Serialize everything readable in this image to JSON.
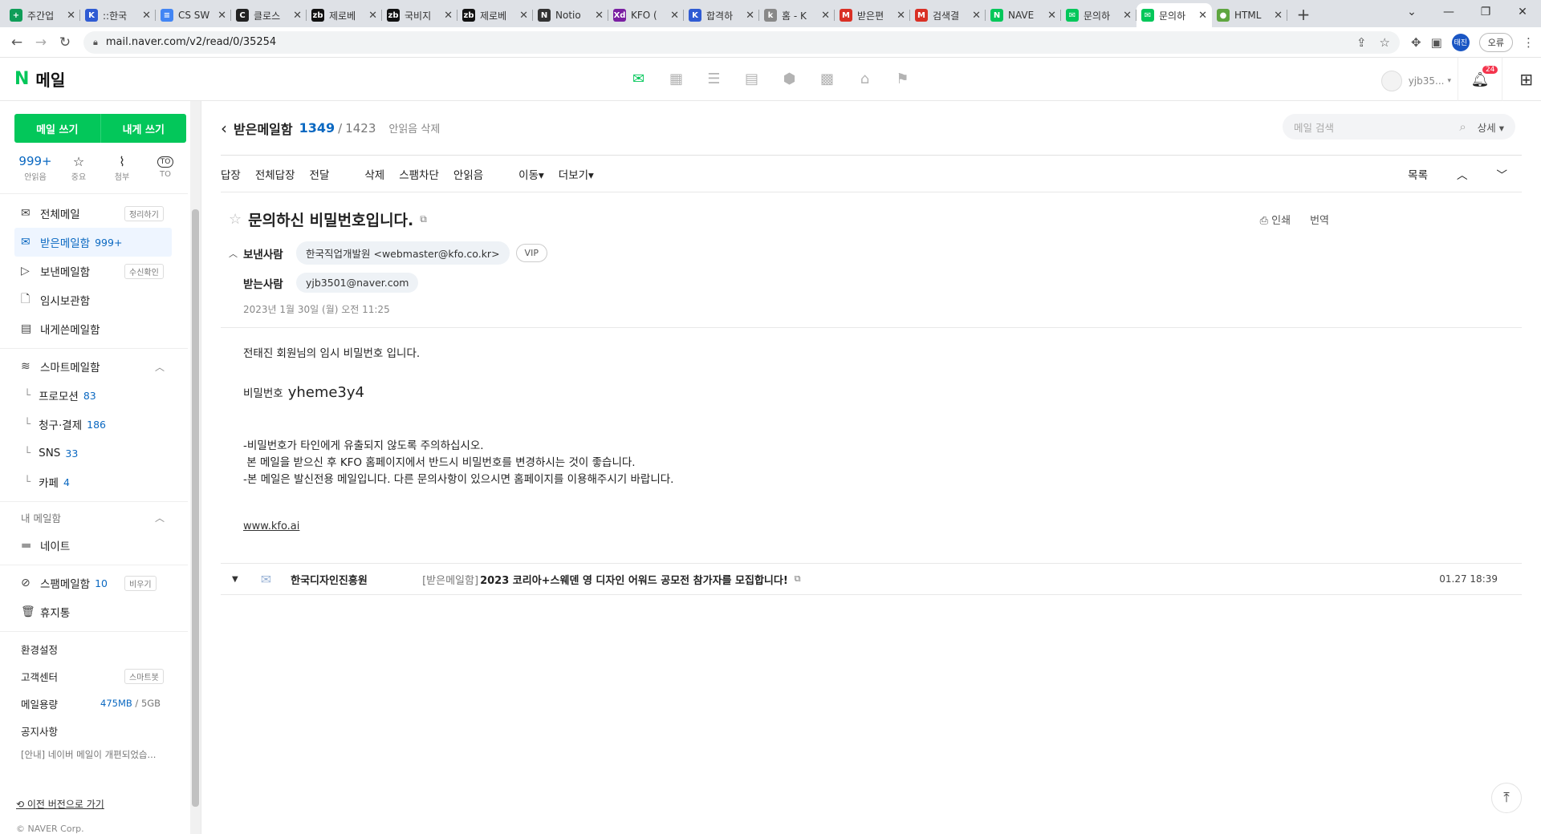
{
  "browser": {
    "tabs": [
      {
        "title": "주간업",
        "color": "#0f9d58",
        "glyph": "+"
      },
      {
        "title": "::한국",
        "color": "#2f5bd3",
        "glyph": "K"
      },
      {
        "title": "CS SW",
        "color": "#4285f4",
        "glyph": "≡"
      },
      {
        "title": "클로스",
        "color": "#222222",
        "glyph": "C"
      },
      {
        "title": "제로베",
        "color": "#111111",
        "glyph": "zb"
      },
      {
        "title": "국비지",
        "color": "#111111",
        "glyph": "zb"
      },
      {
        "title": "제로베",
        "color": "#111111",
        "glyph": "zb"
      },
      {
        "title": "Notio",
        "color": "#333333",
        "glyph": "N"
      },
      {
        "title": "KFO (",
        "color": "#7a1fa2",
        "glyph": "Xd"
      },
      {
        "title": "합격하",
        "color": "#2f5bd3",
        "glyph": "K"
      },
      {
        "title": "홈 - K",
        "color": "#888888",
        "glyph": "k"
      },
      {
        "title": "받은편",
        "color": "#d93025",
        "glyph": "M"
      },
      {
        "title": "검색결",
        "color": "#d93025",
        "glyph": "M"
      },
      {
        "title": "NAVE",
        "color": "#03c75a",
        "glyph": "N"
      },
      {
        "title": "문의하",
        "color": "#03c75a",
        "glyph": "✉"
      },
      {
        "title": "문의하",
        "color": "#03c75a",
        "glyph": "✉",
        "active": true
      },
      {
        "title": "HTML",
        "color": "#5fa640",
        "glyph": "●"
      }
    ],
    "url": "mail.naver.com/v2/read/0/35254",
    "profile_label": "태진",
    "error_label": "오류"
  },
  "header": {
    "logo_n": "N",
    "logo_text": "메일",
    "user": "yjb35...",
    "notif_count": "24"
  },
  "sidebar": {
    "write_label": "메일 쓰기",
    "self_write_label": "내게 쓰기",
    "quick": {
      "unread_count": "999+",
      "unread_label": "안읽음",
      "important_label": "중요",
      "attach_label": "첨부",
      "to_label": "TO"
    },
    "folders": {
      "all": {
        "label": "전체메일",
        "tag": "정리하기"
      },
      "inbox": {
        "label": "받은메일함",
        "count": "999+"
      },
      "sent": {
        "label": "보낸메일함",
        "tag": "수신확인"
      },
      "drafts": {
        "label": "임시보관함"
      },
      "self": {
        "label": "내게쓴메일함"
      },
      "smart": {
        "label": "스마트메일함"
      },
      "promo": {
        "label": "프로모션",
        "count": "83"
      },
      "billing": {
        "label": "청구·결제",
        "count": "186"
      },
      "sns": {
        "label": "SNS",
        "count": "33"
      },
      "cafe": {
        "label": "카페",
        "count": "4"
      },
      "my_mailbox": {
        "label": "내 메일함"
      },
      "note": {
        "label": "네이트"
      },
      "spam": {
        "label": "스팸메일함",
        "count": "10",
        "tag": "비우기"
      },
      "trash": {
        "label": "휴지통"
      }
    },
    "settings_label": "환경설정",
    "support_label": "고객센터",
    "support_tag": "스마트봇",
    "quota_label": "메일용량",
    "quota_used": "475MB",
    "quota_sep": "/",
    "quota_total": "5GB",
    "notice_label": "공지사항",
    "notice_text": "[안내] 네이버 메일이 개편되었습...",
    "prev_version": "이전 버전으로 가기",
    "copyright": "© NAVER Corp."
  },
  "mailbox": {
    "name": "받은메일함",
    "unread": "1349",
    "sep": "/",
    "total": "1423",
    "delete_unread": "안읽음 삭제",
    "search_placeholder": "메일 검색",
    "detail_label": "상세 ▾"
  },
  "toolbar": {
    "reply": "답장",
    "reply_all": "전체답장",
    "forward": "전달",
    "delete": "삭제",
    "block_spam": "스팸차단",
    "mark_unread": "안읽음",
    "move": "이동▾",
    "more": "더보기▾",
    "list": "목록"
  },
  "mail": {
    "subject": "문의하신 비밀번호입니다.",
    "print": "인쇄",
    "translate": "번역",
    "from_label": "보낸사람",
    "from": "한국직업개발원 <webmaster@kfo.co.kr>",
    "vip": "VIP",
    "to_label": "받는사람",
    "to": "yjb3501@naver.com",
    "date": "2023년 1월 30일 (월) 오전 11:25",
    "body_line1": "전태진 회원님의 임시 비밀번호 입니다.",
    "pw_label": "비밀번호",
    "pw_value": "yheme3y4",
    "note1": "-비밀번호가 타인에게 유출되지 않도록 주의하십시오.",
    "note2": " 본 메일을 받으신 후 KFO 홈페이지에서 반드시 비밀번호를 변경하시는 것이 좋습니다.",
    "note3": "-본 메일은 발신전용 메일입니다. 다른 문의사항이 있으시면 홈페이지를 이용해주시기 바랍니다.",
    "link": "www.kfo.ai"
  },
  "next_mail": {
    "sender": "한국디자인진흥원",
    "folder": "[받은메일함]",
    "subject": "2023 코리아+스웨덴 영 디자인 어워드 공모전 참가자를 모집합니다!",
    "time": "01.27 18:39"
  }
}
